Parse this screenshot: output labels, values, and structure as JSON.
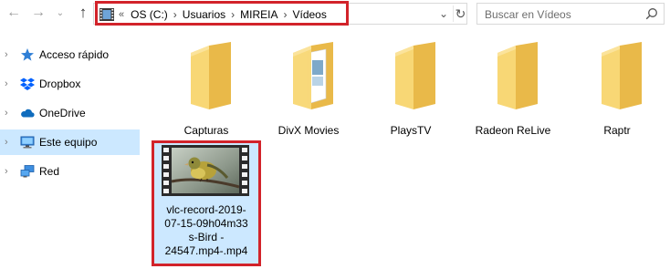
{
  "nav": {
    "back_icon": "←",
    "forward_icon": "→",
    "history_icon": "⌄",
    "up_icon": "↑"
  },
  "address": {
    "overflow": "«",
    "crumbs": [
      "OS (C:)",
      "Usuarios",
      "MIREIA",
      "Vídeos"
    ],
    "separator": "›"
  },
  "search": {
    "placeholder": "Buscar en Vídeos"
  },
  "sidebar": {
    "items": [
      {
        "label": "Acceso rápido",
        "icon": "star-icon",
        "selected": false
      },
      {
        "label": "Dropbox",
        "icon": "dropbox-icon",
        "selected": false
      },
      {
        "label": "OneDrive",
        "icon": "cloud-icon",
        "selected": false
      },
      {
        "label": "Este equipo",
        "icon": "computer-icon",
        "selected": true
      },
      {
        "label": "Red",
        "icon": "network-icon",
        "selected": false
      }
    ]
  },
  "folders": [
    {
      "label": "Capturas"
    },
    {
      "label": "DivX Movies"
    },
    {
      "label": "PlaysTV"
    },
    {
      "label": "Radeon ReLive"
    },
    {
      "label": "Raptr"
    }
  ],
  "video": {
    "label": "vlc-record-2019-07-15-09h04m33s-Bird - 24547.mp4-.mp4",
    "lines": [
      "vlc-record-2019-",
      "07-15-09h04m33",
      "s-Bird -",
      "24547.mp4-.mp4"
    ]
  },
  "colors": {
    "highlight_border": "#d2232a",
    "selection": "#cce8ff",
    "folder": "#f6d170"
  }
}
